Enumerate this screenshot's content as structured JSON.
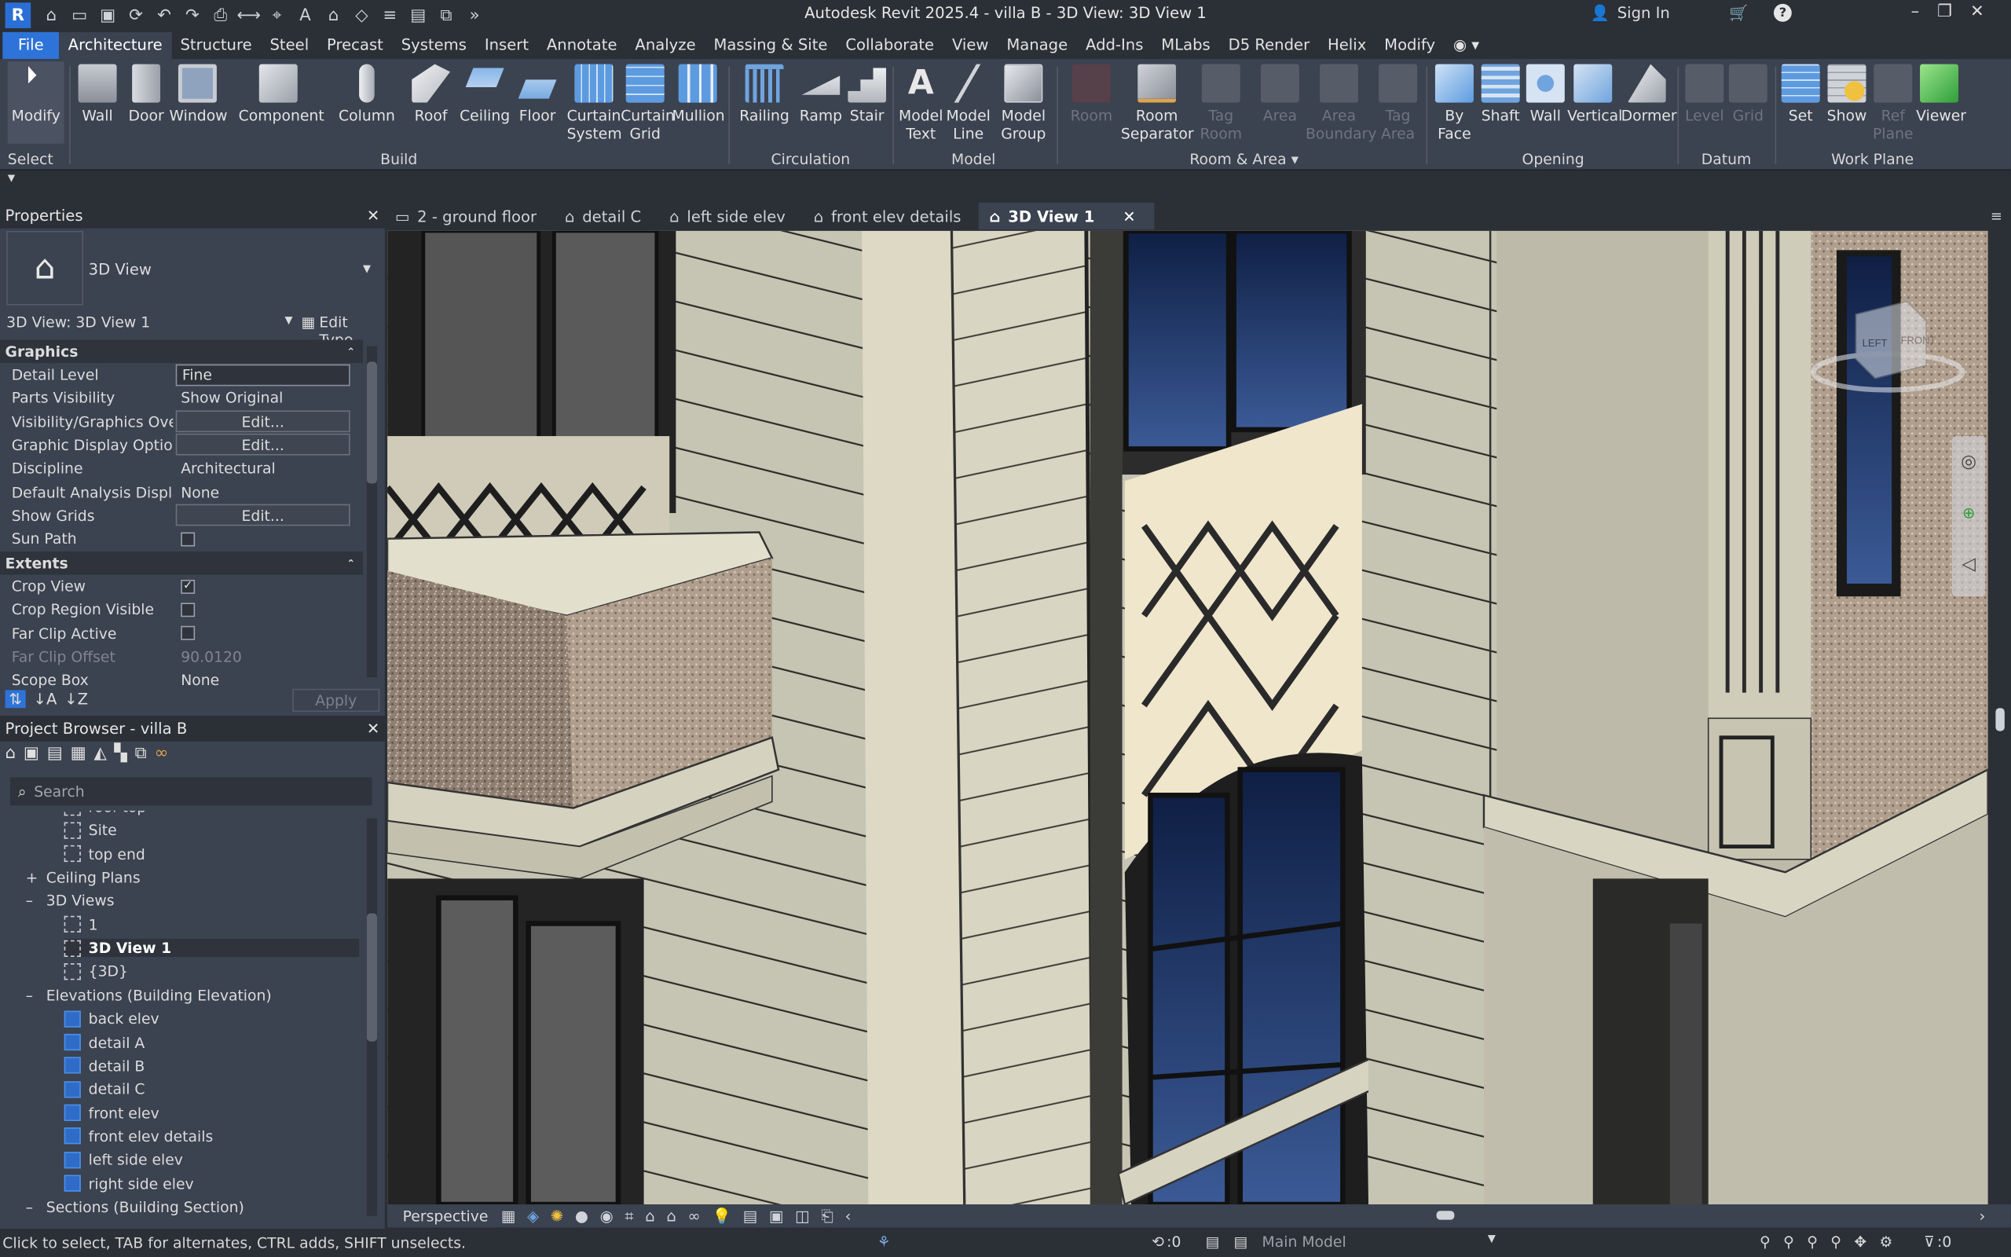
{
  "window": {
    "title": "Autodesk Revit 2025.4 - villa B - 3D View: 3D View 1",
    "sign_in": "Sign In",
    "logo_letter": "R"
  },
  "ribbon_tabs": [
    "File",
    "Architecture",
    "Structure",
    "Steel",
    "Precast",
    "Systems",
    "Insert",
    "Annotate",
    "Analyze",
    "Massing & Site",
    "Collaborate",
    "View",
    "Manage",
    "Add-Ins",
    "MLabs",
    "D5 Render",
    "Helix",
    "Modify"
  ],
  "ribbon": {
    "tools": {
      "modify": "Modify",
      "wall": "Wall",
      "door": "Door",
      "window": "Window",
      "component": "Component",
      "column": "Column",
      "roof": "Roof",
      "ceiling": "Ceiling",
      "floor": "Floor",
      "curtain_system": [
        "Curtain",
        "System"
      ],
      "curtain_grid": [
        "Curtain",
        "Grid"
      ],
      "mullion": "Mullion",
      "railing": "Railing",
      "ramp": "Ramp",
      "stair": "Stair",
      "model_text": [
        "Model",
        "Text"
      ],
      "model_line": [
        "Model",
        "Line"
      ],
      "model_group": [
        "Model",
        "Group"
      ],
      "room": "Room",
      "room_separator": [
        "Room",
        "Separator"
      ],
      "tag_room": [
        "Tag",
        "Room"
      ],
      "area": "Area",
      "area_boundary": [
        "Area",
        "Boundary"
      ],
      "tag_area": [
        "Tag",
        "Area"
      ],
      "by_face": [
        "By",
        "Face"
      ],
      "shaft": "Shaft",
      "wall_opening": "Wall",
      "vertical": "Vertical",
      "dormer": "Dormer",
      "level": "Level",
      "grid": "Grid",
      "set": "Set",
      "show": "Show",
      "ref_plane": [
        "Ref",
        "Plane"
      ],
      "viewer": "Viewer"
    },
    "groups": {
      "select": "Select",
      "build": "Build",
      "circulation": "Circulation",
      "model": "Model",
      "room_area": "Room & Area",
      "opening": "Opening",
      "datum": "Datum",
      "work_plane": "Work Plane"
    }
  },
  "view_tabs": [
    "2 - ground floor",
    "detail C",
    "left side elev",
    "front elev details",
    "3D View 1"
  ],
  "properties": {
    "title": "Properties",
    "type_name": "3D View",
    "instance": "3D View: 3D View 1",
    "edit_type": "Edit Type",
    "apply": "Apply",
    "graphics_label": "Graphics",
    "extents_label": "Extents",
    "graphics": [
      {
        "key": "Detail Level",
        "value": "Fine"
      },
      {
        "key": "Parts Visibility",
        "value": "Show Original"
      },
      {
        "key": "Visibility/Graphics Overri...",
        "value": "Edit..."
      },
      {
        "key": "Graphic Display Options",
        "value": "Edit..."
      },
      {
        "key": "Discipline",
        "value": "Architectural"
      },
      {
        "key": "Default Analysis Display ...",
        "value": "None"
      },
      {
        "key": "Show Grids",
        "value": "Edit..."
      },
      {
        "key": "Sun Path",
        "value": ""
      }
    ],
    "extents": [
      {
        "key": "Crop View",
        "value": ""
      },
      {
        "key": "Crop Region Visible",
        "value": ""
      },
      {
        "key": "Far Clip Active",
        "value": ""
      },
      {
        "key": "Far Clip Offset",
        "value": "90.0120"
      },
      {
        "key": "Scope Box",
        "value": "None"
      }
    ]
  },
  "project_browser": {
    "title": "Project Browser - villa B",
    "search_placeholder": "Search",
    "nodes": [
      {
        "label": "roof top",
        "type": "view"
      },
      {
        "label": "Site",
        "type": "view"
      },
      {
        "label": "top end",
        "type": "view"
      },
      {
        "label": "Ceiling Plans",
        "type": "group-collapsed"
      },
      {
        "label": "3D Views",
        "type": "group-expanded"
      },
      {
        "label": "1",
        "type": "view"
      },
      {
        "label": "3D View 1",
        "type": "view-active"
      },
      {
        "label": "{3D}",
        "type": "view"
      },
      {
        "label": "Elevations (Building Elevation)",
        "type": "group-expanded"
      },
      {
        "label": "back elev",
        "type": "elev"
      },
      {
        "label": "detail A",
        "type": "elev"
      },
      {
        "label": "detail B",
        "type": "elev"
      },
      {
        "label": "detail C",
        "type": "elev"
      },
      {
        "label": "front elev",
        "type": "elev"
      },
      {
        "label": "front elev details",
        "type": "elev"
      },
      {
        "label": "left side elev",
        "type": "elev"
      },
      {
        "label": "right side elev",
        "type": "elev"
      },
      {
        "label": "Sections (Building Section)",
        "type": "group-expanded"
      }
    ]
  },
  "viewcube": {
    "left": "LEFT",
    "front": "FRONT"
  },
  "view_control": {
    "projection": "Perspective"
  },
  "status": {
    "hint": "Click to select, TAB for alternates, CTRL adds, SHIFT unselects.",
    "worksharing_count": ":0",
    "model": "Main Model",
    "filter_count": ":0"
  },
  "colors": {
    "accent": "#2d73d9",
    "panel": "#3b4250",
    "chrome": "#2b2f36"
  }
}
